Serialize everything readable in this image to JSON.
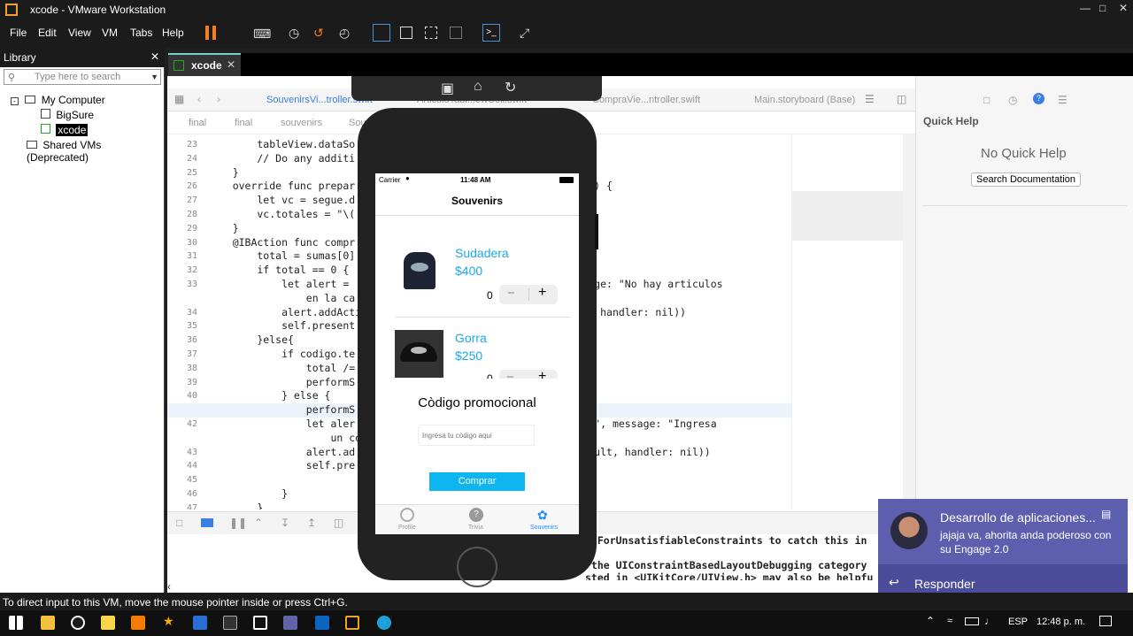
{
  "window": {
    "title": "xcode - VMware Workstation"
  },
  "menu": [
    "File",
    "Edit",
    "View",
    "VM",
    "Tabs",
    "Help"
  ],
  "library": {
    "title": "Library",
    "search_placeholder": "Type here to search",
    "items": [
      "My Computer",
      "BigSure",
      "xcode",
      "Shared VMs (Deprecated)"
    ]
  },
  "vm_tab": "xcode",
  "xcode": {
    "tabs": [
      "SouvenirsVi...troller.swift",
      "ArticuloTabl...ewCell.swift",
      "CompraVie...ntroller.swift",
      "Main.storyboard (Base)"
    ],
    "breadcrumb": [
      "final",
      "final",
      "souvenirs",
      "Sou"
    ],
    "quick_help": {
      "title": "Quick Help",
      "empty": "No Quick Help",
      "button": "Search Documentation"
    },
    "code_lines": [
      {
        "n": "23",
        "t": "        tableView.dataSo"
      },
      {
        "n": "24",
        "t": "        // Do any additi"
      },
      {
        "n": "25",
        "t": "    }"
      },
      {
        "n": "26",
        "t": "    override func prepar                                   Any?) {"
      },
      {
        "n": "27",
        "t": "        let vc = segue.d"
      },
      {
        "n": "28",
        "t": "        vc.totales = \"\\("
      },
      {
        "n": "29",
        "t": "    }"
      },
      {
        "n": "30",
        "t": "    @IBAction func compr"
      },
      {
        "n": "31",
        "t": "        total = sumas[0]"
      },
      {
        "n": "32",
        "t": "        if total == 0 {"
      },
      {
        "n": "33",
        "t": "            let alert =                                \", message: \"No hay articulos"
      },
      {
        "n": "",
        "t": "                en la ca"
      },
      {
        "n": "34",
        "t": "            alert.addActi                              default, handler: nil))"
      },
      {
        "n": "35",
        "t": "            self.present                               )"
      },
      {
        "n": "36",
        "t": "        }else{"
      },
      {
        "n": "37",
        "t": "            if codigo.te"
      },
      {
        "n": "38",
        "t": "                total /="
      },
      {
        "n": "39",
        "t": "                performS                               : nil)"
      },
      {
        "n": "40",
        "t": "            } else {"
      },
      {
        "n": "41",
        "t": "                performS                               : nil)"
      },
      {
        "n": "42",
        "t": "                let aler                               correcto\", message: \"Ingresa"
      },
      {
        "n": "",
        "t": "                    un co"
      },
      {
        "n": "43",
        "t": "                alert.ad                               e: .default, handler: nil))"
      },
      {
        "n": "44",
        "t": "                self.pre                               nil)"
      },
      {
        "n": "45",
        "t": ""
      },
      {
        "n": "46",
        "t": "            }"
      },
      {
        "n": "47",
        "t": "        }"
      }
    ],
    "console": [
      "ltForUnsatisfiableConstraints to catch this in",
      "",
      " the UIConstraintBasedLayoutDebugging category",
      "sted in <UIKitCore/UIView.h> may also be helpfu"
    ]
  },
  "phone": {
    "carrier": "Carrier",
    "time": "11:48 AM",
    "nav_title": "Souvenirs",
    "products": [
      {
        "name": "Sudadera",
        "price": "$400",
        "qty": "0"
      },
      {
        "name": "Gorra",
        "price": "$250",
        "qty": "0"
      }
    ],
    "promo_title": "Còdigo promocional",
    "promo_placeholder": "Ingresa tu còdigo aqui",
    "buy_button": "Comprar",
    "tabs": [
      "Profile",
      "Trivia",
      "Souvenirs"
    ]
  },
  "notification": {
    "title": "Desarrollo de aplicaciones...",
    "body": "jajaja va, ahorita anda poderoso con su Engage 2.0",
    "action": "Responder"
  },
  "status_text": "To direct input to this VM, move the mouse pointer inside or press Ctrl+G.",
  "taskbar": {
    "lang": "ESP",
    "time": "12:48 p. m."
  },
  "colors": {
    "accent_blue": "#1aa7ec",
    "notif": "#5d5fae"
  }
}
